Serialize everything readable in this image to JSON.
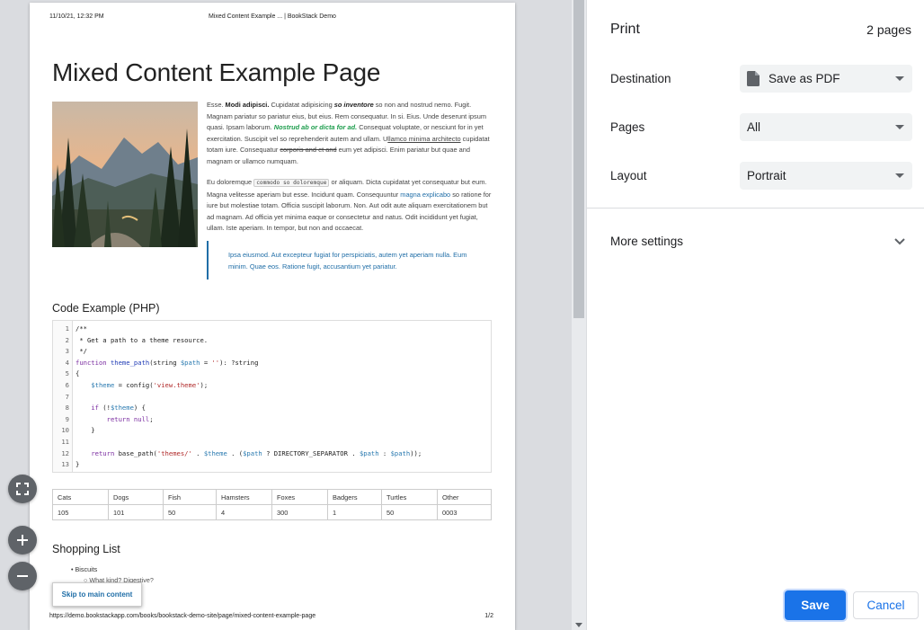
{
  "preview": {
    "header": {
      "date": "11/10/21, 12:32 PM",
      "title": "Mixed Content Example ... | BookStack Demo"
    },
    "footer": {
      "url": "https://demo.bookstackapp.com/books/bookstack-demo-site/page/mixed-content-example-page",
      "page_num": "1/2"
    },
    "doc_title": "Mixed Content Example Page",
    "p1": {
      "a": "Esse. ",
      "b": "Modi adipisci.",
      "c": " Cupidatat adipisicing ",
      "d": "so inventore",
      "e": " so non and nostrud nemo. Fugit. Magnam pariatur so pariatur eius, but eius. Rem consequatur. In si. Eius. Unde deserunt ipsum quasi. Ipsam laborum. ",
      "f": "Nostrud ab or dicta for ad.",
      "g": " Consequat voluptate, or nesciunt for in yet exercitation. Suscipit vel so reprehenderit autem and ullam. U",
      "h": "llamco minima architecto",
      "i": " cupidatat totam iure. Consequatur ",
      "j": "corporis and et and",
      "k": " eum yet adipisci. Enim pariatur but quae and magnam or ullamco numquam."
    },
    "p2": {
      "a": "Eu doloremque ",
      "code": "commodo so doloremque",
      "b": " or aliquam. Dicta cupidatat yet consequatur but eum. Magna velitesse aperiam but esse. Incidunt quam. Consequuntur ",
      "link": "magna explicabo",
      "c": " so ratione for iure but molestiae totam. Officia suscipit laborum. Non. Aut odit aute aliquam exercitationem but ad magnam. Ad officia yet minima eaque or consectetur and natus. Odit incididunt yet fugiat, ullam. Iste aperiam. In tempor, but non and occaecat."
    },
    "blockquote": "Ipsa eiusmod. Aut excepteur fugiat for perspiciatis, autem yet aperiam nulla. Eum minim. Quae eos. Ratione fugit, accusantium yet pariatur.",
    "code_heading": "Code Example (PHP)",
    "code_line_numbers": [
      "1",
      "2",
      "3",
      "4",
      "5",
      "6",
      "7",
      "8",
      "9",
      "10",
      "11",
      "12",
      "13"
    ],
    "code_text": {
      "l1": "/**",
      "l2": " * Get a path to a theme resource.",
      "l3": " */",
      "l4a": "function ",
      "l4b": "theme_path",
      "l4c": "(string ",
      "l4d": "$path",
      "l4e": " = ",
      "l4f": "''",
      "l4g": "): ?string",
      "l5": "{",
      "l6a": "    ",
      "l6b": "$theme",
      "l6c": " = config(",
      "l6d": "'view.theme'",
      "l6e": ");",
      "l8a": "    ",
      "l8b": "if",
      "l8c": " (!",
      "l8d": "$theme",
      "l8e": ") {",
      "l9a": "        ",
      "l9b": "return",
      "l9c": " ",
      "l9d": "null",
      "l9e": ";",
      "l10": "    }",
      "l12a": "    ",
      "l12b": "return",
      "l12c": " base_path(",
      "l12d": "'themes/'",
      "l12e": " . ",
      "l12f": "$theme",
      "l12g": " . (",
      "l12h": "$path",
      "l12i": " ? DIRECTORY_SEPARATOR . ",
      "l12j": "$path",
      "l12k": " : ",
      "l12l": "$path",
      "l12m": "));",
      "l13": "}"
    },
    "table": {
      "headers": [
        "Cats",
        "Dogs",
        "Fish",
        "Hamsters",
        "Foxes",
        "Badgers",
        "Turtles",
        "Other"
      ],
      "row": [
        "105",
        "101",
        "50",
        "4",
        "300",
        "1",
        "50",
        "0003"
      ]
    },
    "shopping_heading": "Shopping List",
    "shopping_items": [
      "Biscuits",
      "What kind? Digestive?"
    ],
    "skip_link": "Skip to main content"
  },
  "sidebar": {
    "title": "Print",
    "pages_count": "2 pages",
    "destination_label": "Destination",
    "destination_value": "Save as PDF",
    "pages_label": "Pages",
    "pages_value": "All",
    "layout_label": "Layout",
    "layout_value": "Portrait",
    "more_settings": "More settings",
    "save_label": "Save",
    "cancel_label": "Cancel"
  },
  "icons": {
    "fit": "fit-to-page-icon",
    "zoom_in": "zoom-in-icon",
    "zoom_out": "zoom-out-icon",
    "pdf": "pdf-file-icon",
    "chevron": "chevron-down-icon"
  },
  "colors": {
    "accent": "#1a73e8",
    "link": "#206ea7"
  }
}
